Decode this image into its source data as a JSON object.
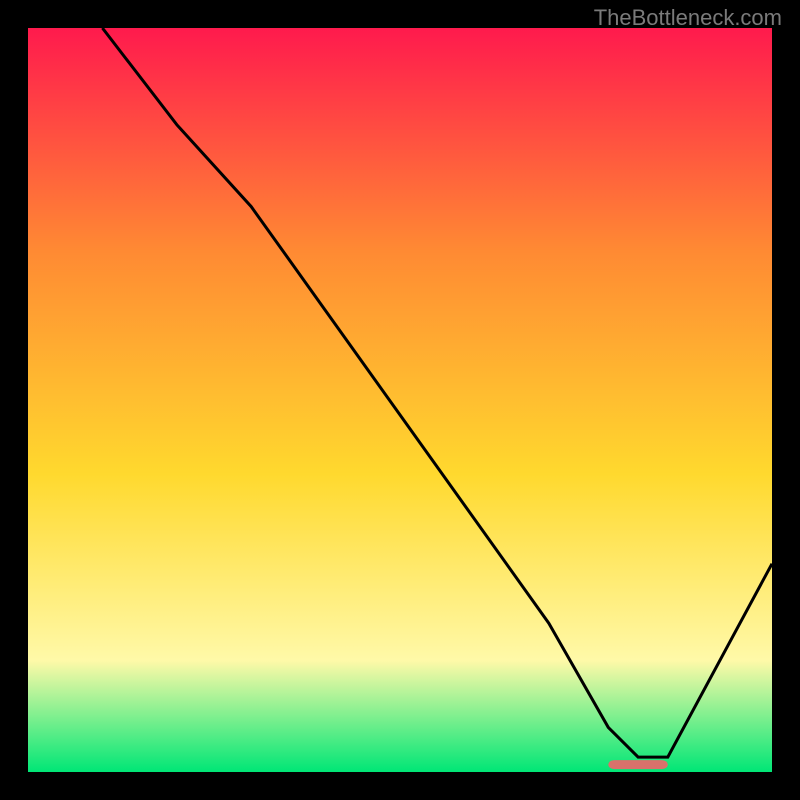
{
  "watermark": "TheBottleneck.com",
  "chart_data": {
    "type": "line",
    "title": "",
    "xlabel": "",
    "ylabel": "",
    "xlim": [
      0,
      100
    ],
    "ylim": [
      0,
      100
    ],
    "grid": false,
    "legend_position": "none",
    "background_gradient": {
      "top_color": "#ff1a4d",
      "mid_upper_color": "#ff8a33",
      "mid_color": "#ffd92e",
      "mid_lower_color": "#fff9a8",
      "bottom_color": "#00e676"
    },
    "series": [
      {
        "name": "bottleneck-curve",
        "x": [
          10,
          20,
          30,
          40,
          50,
          60,
          70,
          78,
          82,
          86,
          100
        ],
        "values": [
          100,
          87,
          76,
          62,
          48,
          34,
          20,
          6,
          2,
          2,
          28
        ],
        "stroke": "#000000",
        "width": 2
      }
    ],
    "markers": [
      {
        "name": "optimal-range-marker",
        "x_start": 78,
        "x_end": 86,
        "y": 1,
        "color": "#d9716b",
        "thickness": 3
      }
    ]
  }
}
